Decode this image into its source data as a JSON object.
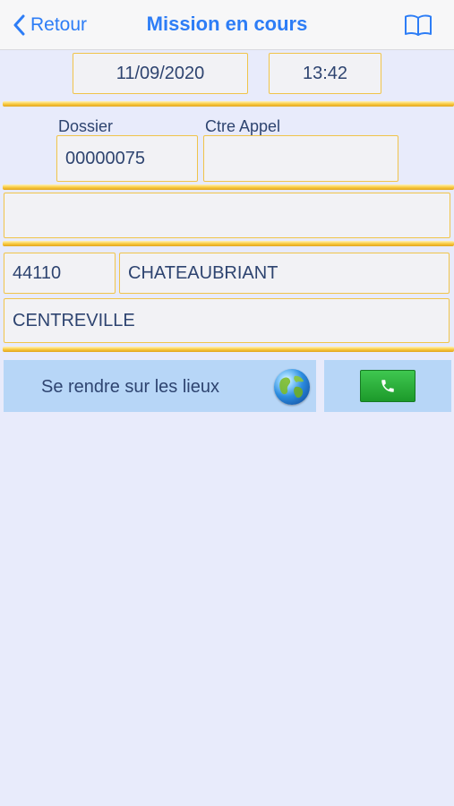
{
  "nav": {
    "back_label": "Retour",
    "title": "Mission en cours",
    "back_icon": "chevron-left-icon",
    "book_icon": "book-icon"
  },
  "datetime": {
    "date": "11/09/2020",
    "time": "13:42"
  },
  "labels": {
    "dossier": "Dossier",
    "ctre_appel": "Ctre Appel"
  },
  "fields": {
    "dossier": "00000075",
    "ctre_appel": "",
    "info": "",
    "postal_code": "44110",
    "city": "CHATEAUBRIANT",
    "address": "CENTREVILLE"
  },
  "actions": {
    "go_to_site_label": "Se rendre sur les lieux",
    "globe_icon": "globe-icon",
    "phone_icon": "phone-icon"
  },
  "colors": {
    "accent": "#2d7df6",
    "background": "#e8ebfb",
    "field_border": "#f0c44a",
    "button_bg": "#b7d6f7",
    "phone_green": "#2bb13b",
    "text": "#2e4470"
  }
}
